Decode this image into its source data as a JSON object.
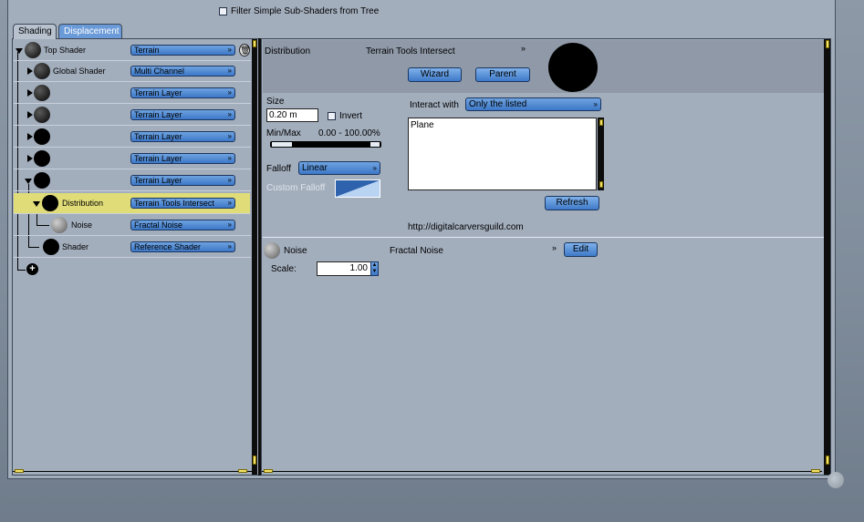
{
  "filter": {
    "label": "Filter Simple Sub-Shaders from Tree",
    "checked": false
  },
  "tabs": [
    {
      "label": "Shading",
      "active": true
    },
    {
      "label": "Displacement",
      "active": false
    }
  ],
  "tree": {
    "rows": [
      {
        "name": "Top Shader",
        "type": "Terrain",
        "ball": "textured",
        "expander": "down"
      },
      {
        "name": "Global Shader",
        "type": "Multi Channel",
        "ball": "textured",
        "expander": "right"
      },
      {
        "name": "",
        "type": "Terrain Layer",
        "ball": "textured",
        "expander": "right"
      },
      {
        "name": "",
        "type": "Terrain Layer",
        "ball": "textured",
        "expander": "right"
      },
      {
        "name": "",
        "type": "Terrain Layer",
        "ball": "black",
        "expander": "right"
      },
      {
        "name": "",
        "type": "Terrain Layer",
        "ball": "black",
        "expander": "right"
      },
      {
        "name": "",
        "type": "Terrain Layer",
        "ball": "black",
        "expander": "down"
      },
      {
        "name": "Distribution",
        "type": "Terrain Tools Intersect",
        "ball": "black",
        "expander": "down",
        "selected": true
      },
      {
        "name": "Noise",
        "type": "Fractal Noise",
        "ball": "noise",
        "expander": "none"
      },
      {
        "name": "Shader",
        "type": "Reference Shader",
        "ball": "black",
        "expander": "none"
      }
    ],
    "add_icon": "add-circle-icon",
    "delete_icon": "trash-icon"
  },
  "editor": {
    "title": "Distribution",
    "shader_type": "Terrain Tools Intersect",
    "wizard_label": "Wizard",
    "parent_label": "Parent",
    "size_label": "Size",
    "size_value": "0.20 m",
    "invert_label": "Invert",
    "minmax_label": "Min/Max",
    "minmax_value": "0.00 - 100.00%",
    "falloff_label": "Falloff",
    "falloff_value": "Linear",
    "custom_falloff_label": "Custom Falloff",
    "interact_label": "Interact with",
    "interact_value": "Only the listed",
    "list_items": [
      "Plane"
    ],
    "refresh_label": "Refresh",
    "url": "http://digitalcarversguild.com",
    "noise_label": "Noise",
    "noise_type": "Fractal Noise",
    "edit_label": "Edit",
    "scale_label": "Scale:",
    "scale_value": "1.00"
  },
  "colors": {
    "accent": "#4a84d0",
    "selection": "#e0dc78",
    "panel": "#a3aebd"
  }
}
